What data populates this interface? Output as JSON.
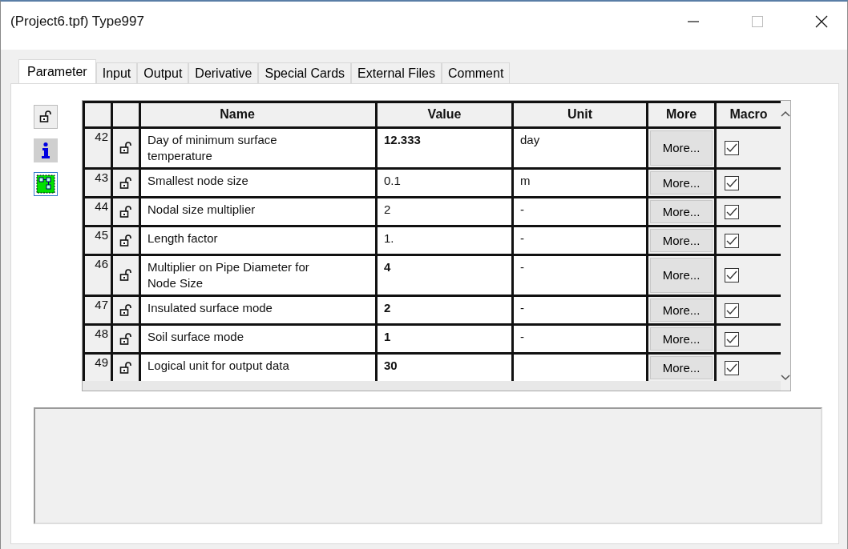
{
  "window": {
    "title": "(Project6.tpf) Type997"
  },
  "tabs": [
    {
      "label": "Parameter",
      "selected": true
    },
    {
      "label": "Input",
      "selected": false
    },
    {
      "label": "Output",
      "selected": false
    },
    {
      "label": "Derivative",
      "selected": false
    },
    {
      "label": "Special Cards",
      "selected": false
    },
    {
      "label": "External Files",
      "selected": false
    },
    {
      "label": "Comment",
      "selected": false
    }
  ],
  "table": {
    "columns": [
      "Name",
      "Value",
      "Unit",
      "More",
      "Macro"
    ],
    "rows": [
      {
        "index": "42",
        "name": "Day of minimum surface temperature",
        "value": "12.333",
        "bold": true,
        "unit": "day",
        "more": "More...",
        "macro": true
      },
      {
        "index": "43",
        "name": "Smallest node size",
        "value": "0.1",
        "bold": false,
        "unit": "m",
        "more": "More...",
        "macro": true
      },
      {
        "index": "44",
        "name": "Nodal size multiplier",
        "value": "2",
        "bold": false,
        "unit": "-",
        "more": "More...",
        "macro": true
      },
      {
        "index": "45",
        "name": "Length factor",
        "value": "1.",
        "bold": false,
        "unit": "-",
        "more": "More...",
        "macro": true
      },
      {
        "index": "46",
        "name": "Multiplier on Pipe Diameter for Node Size",
        "value": "4",
        "bold": true,
        "unit": "-",
        "more": "More...",
        "macro": true
      },
      {
        "index": "47",
        "name": "Insulated surface mode",
        "value": "2",
        "bold": true,
        "unit": "-",
        "more": "More...",
        "macro": true
      },
      {
        "index": "48",
        "name": "Soil surface mode",
        "value": "1",
        "bold": true,
        "unit": "-",
        "more": "More...",
        "macro": true
      },
      {
        "index": "49",
        "name": "Logical unit for output data",
        "value": "30",
        "bold": true,
        "unit": "",
        "more": "More...",
        "macro": true
      }
    ]
  }
}
